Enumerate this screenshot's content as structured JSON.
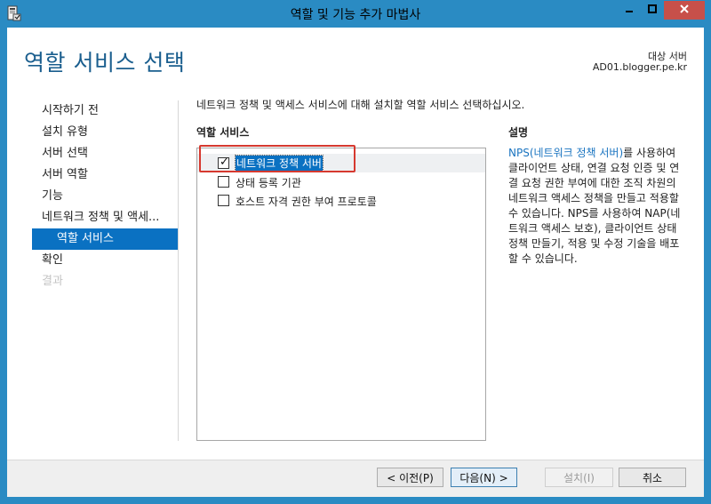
{
  "window": {
    "title": "역할 및 기능 추가 마법사",
    "controls": {
      "minimize": "—",
      "maximize": "□",
      "close": "✕"
    }
  },
  "header": {
    "page_title": "역할 서비스 선택",
    "target_label": "대상 서버",
    "target_value": "AD01.blogger.pe.kr"
  },
  "nav": {
    "items": [
      {
        "label": "시작하기 전",
        "state": "normal"
      },
      {
        "label": "설치 유형",
        "state": "normal"
      },
      {
        "label": "서버 선택",
        "state": "normal"
      },
      {
        "label": "서버 역할",
        "state": "normal"
      },
      {
        "label": "기능",
        "state": "normal"
      },
      {
        "label": "네트워크 정책 및 액세...",
        "state": "normal"
      },
      {
        "label": "역할 서비스",
        "state": "selected"
      },
      {
        "label": "확인",
        "state": "normal"
      },
      {
        "label": "결과",
        "state": "disabled"
      }
    ]
  },
  "main": {
    "instruction": "네트워크 정책 및 액세스 서비스에 대해 설치할 역할 서비스 선택하십시오.",
    "roles_heading": "역할 서비스",
    "roles": [
      {
        "label": "네트워크 정책 서버",
        "checked": "✓"
      },
      {
        "label": "상태 등록 기관",
        "checked": ""
      },
      {
        "label": "호스트 자격 권한 부여 프로토콜",
        "checked": ""
      }
    ],
    "description_heading": "설명",
    "description_link": "NPS(네트워크 정책 서버)",
    "description_body": "를 사용하여 클라이언트 상태, 연결 요청 인증 및 연결 요청 권한 부여에 대한 조직 차원의 네트워크 액세스 정책을 만들고 적용할 수 있습니다. NPS를 사용하여 NAP(네트워크 액세스 보호), 클라이언트 상태 정책 만들기, 적용 및 수정 기술을 배포할 수 있습니다."
  },
  "footer": {
    "prev_label": "< 이전(P)",
    "next_label": "다음(N) >",
    "install_label": "설치(I)",
    "cancel_label": "취소"
  },
  "colors": {
    "titlebar": "#2a8bc3",
    "close_button": "#c7504a",
    "selection": "#0a71c2",
    "page_title": "#1a5e8e",
    "highlight_box": "#d6392f"
  },
  "icons": [
    "server-manager-app-icon",
    "minimize-icon",
    "maximize-icon",
    "close-icon",
    "checkbox-checked-icon"
  ]
}
